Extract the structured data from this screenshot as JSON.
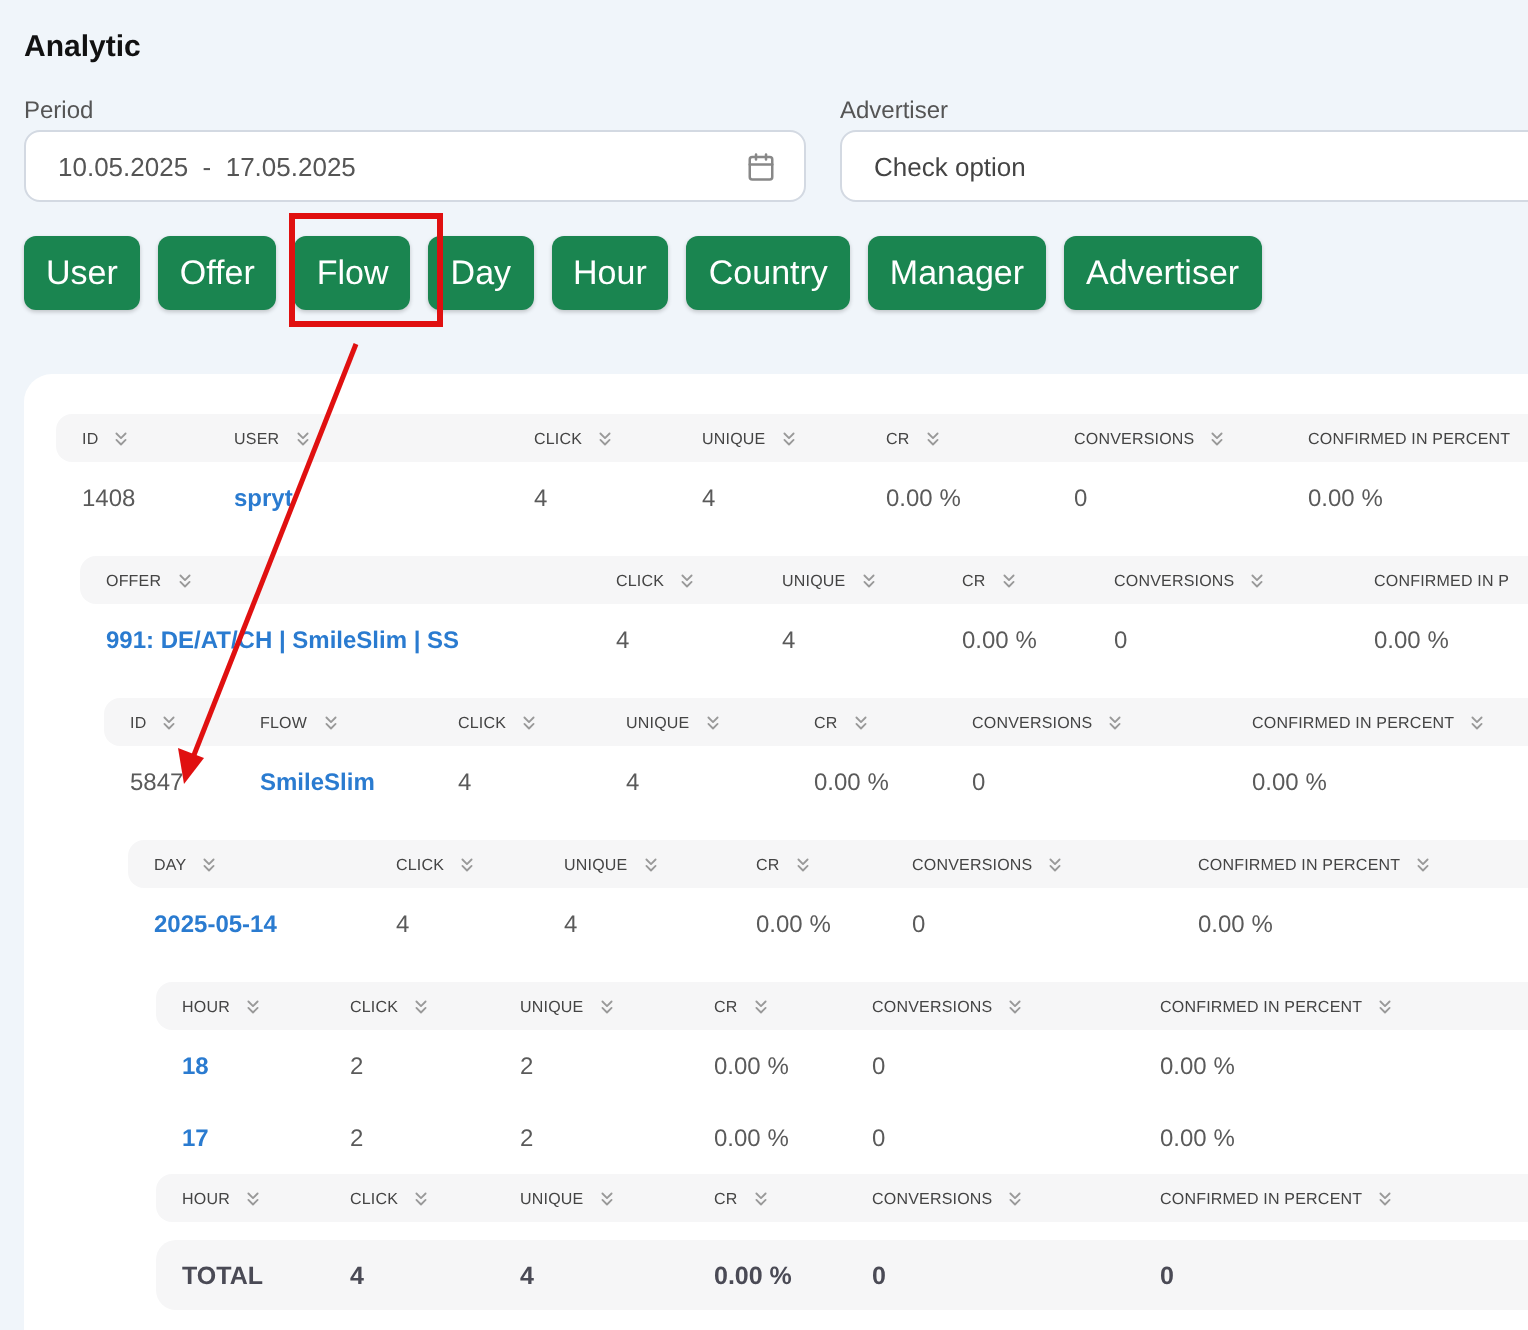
{
  "title": "Analytic",
  "filters": [
    {
      "label": "Period",
      "value": "10.05.2025  -  17.05.2025",
      "kind": "date"
    },
    {
      "label": "Advertiser",
      "placeholder": "Check option",
      "kind": "select"
    }
  ],
  "group_buttons": [
    {
      "label": "User"
    },
    {
      "label": "Offer"
    },
    {
      "label": "Flow"
    },
    {
      "label": "Day"
    },
    {
      "label": "Hour"
    },
    {
      "label": "Country"
    },
    {
      "label": "Manager"
    },
    {
      "label": "Advertiser"
    }
  ],
  "report": {
    "columns": [
      {
        "label": "ID",
        "sort": true
      },
      {
        "label": "USER",
        "sort": true
      },
      {
        "label": "CLICK",
        "sort": true
      },
      {
        "label": "UNIQUE",
        "sort": true
      },
      {
        "label": "CR",
        "sort": true
      },
      {
        "label": "CONVERSIONS",
        "sort": true
      },
      {
        "label": "CONFIRMED IN PERCENT",
        "sort": false
      }
    ],
    "rows": [
      {
        "cells": [
          {
            "text": "1408",
            "link": false
          },
          {
            "text": "spryt",
            "link": true
          },
          {
            "text": "4",
            "link": false
          },
          {
            "text": "4",
            "link": false
          },
          {
            "text": "0.00 %",
            "link": false
          },
          {
            "text": "0",
            "link": false
          },
          {
            "text": "0.00 %",
            "link": false
          }
        ],
        "child": {
          "columns": [
            {
              "label": "OFFER",
              "sort": true
            },
            {
              "label": "CLICK",
              "sort": true
            },
            {
              "label": "UNIQUE",
              "sort": true
            },
            {
              "label": "CR",
              "sort": true
            },
            {
              "label": "CONVERSIONS",
              "sort": true
            },
            {
              "label": "CONFIRMED IN P",
              "sort": false
            }
          ],
          "rows": [
            {
              "cells": [
                {
                  "text": "991: DE/AT/CH | SmileSlim | SS",
                  "link": true
                },
                {
                  "text": "4",
                  "link": false
                },
                {
                  "text": "4",
                  "link": false
                },
                {
                  "text": "0.00 %",
                  "link": false
                },
                {
                  "text": "0",
                  "link": false
                },
                {
                  "text": "0.00 %",
                  "link": false
                }
              ],
              "child": {
                "columns": [
                  {
                    "label": "ID",
                    "sort": true
                  },
                  {
                    "label": "FLOW",
                    "sort": true
                  },
                  {
                    "label": "CLICK",
                    "sort": true
                  },
                  {
                    "label": "UNIQUE",
                    "sort": true
                  },
                  {
                    "label": "CR",
                    "sort": true
                  },
                  {
                    "label": "CONVERSIONS",
                    "sort": true
                  },
                  {
                    "label": "CONFIRMED IN PERCENT",
                    "sort": true
                  }
                ],
                "rows": [
                  {
                    "cells": [
                      {
                        "text": "5847",
                        "link": false
                      },
                      {
                        "text": "SmileSlim",
                        "link": true
                      },
                      {
                        "text": "4",
                        "link": false
                      },
                      {
                        "text": "4",
                        "link": false
                      },
                      {
                        "text": "0.00 %",
                        "link": false
                      },
                      {
                        "text": "0",
                        "link": false
                      },
                      {
                        "text": "0.00 %",
                        "link": false
                      }
                    ],
                    "child": {
                      "columns": [
                        {
                          "label": "DAY",
                          "sort": true
                        },
                        {
                          "label": "CLICK",
                          "sort": true
                        },
                        {
                          "label": "UNIQUE",
                          "sort": true
                        },
                        {
                          "label": "CR",
                          "sort": true
                        },
                        {
                          "label": "CONVERSIONS",
                          "sort": true
                        },
                        {
                          "label": "CONFIRMED IN PERCENT",
                          "sort": true
                        }
                      ],
                      "rows": [
                        {
                          "cells": [
                            {
                              "text": "2025-05-14",
                              "link": true
                            },
                            {
                              "text": "4",
                              "link": false
                            },
                            {
                              "text": "4",
                              "link": false
                            },
                            {
                              "text": "0.00 %",
                              "link": false
                            },
                            {
                              "text": "0",
                              "link": false
                            },
                            {
                              "text": "0.00 %",
                              "link": false
                            }
                          ],
                          "child": {
                            "columns": [
                              {
                                "label": "HOUR",
                                "sort": true
                              },
                              {
                                "label": "CLICK",
                                "sort": true
                              },
                              {
                                "label": "UNIQUE",
                                "sort": true
                              },
                              {
                                "label": "CR",
                                "sort": true
                              },
                              {
                                "label": "CONVERSIONS",
                                "sort": true
                              },
                              {
                                "label": "CONFIRMED IN PERCENT",
                                "sort": true
                              }
                            ],
                            "rows": [
                              {
                                "cells": [
                                  {
                                    "text": "18",
                                    "link": true
                                  },
                                  {
                                    "text": "2",
                                    "link": false
                                  },
                                  {
                                    "text": "2",
                                    "link": false
                                  },
                                  {
                                    "text": "0.00 %",
                                    "link": false
                                  },
                                  {
                                    "text": "0",
                                    "link": false
                                  },
                                  {
                                    "text": "0.00 %",
                                    "link": false
                                  }
                                ]
                              },
                              {
                                "cells": [
                                  {
                                    "text": "17",
                                    "link": true
                                  },
                                  {
                                    "text": "2",
                                    "link": false
                                  },
                                  {
                                    "text": "2",
                                    "link": false
                                  },
                                  {
                                    "text": "0.00 %",
                                    "link": false
                                  },
                                  {
                                    "text": "0",
                                    "link": false
                                  },
                                  {
                                    "text": "0.00 %",
                                    "link": false
                                  }
                                ]
                              }
                            ],
                            "footer_columns": [
                              {
                                "label": "HOUR",
                                "sort": true
                              },
                              {
                                "label": "CLICK",
                                "sort": true
                              },
                              {
                                "label": "UNIQUE",
                                "sort": true
                              },
                              {
                                "label": "CR",
                                "sort": true
                              },
                              {
                                "label": "CONVERSIONS",
                                "sort": true
                              },
                              {
                                "label": "CONFIRMED IN PERCENT",
                                "sort": true
                              }
                            ],
                            "total": [
                              "TOTAL",
                              "4",
                              "4",
                              "0.00 %",
                              "0",
                              "0"
                            ]
                          }
                        }
                      ]
                    }
                  }
                ]
              }
            }
          ]
        }
      }
    ]
  }
}
